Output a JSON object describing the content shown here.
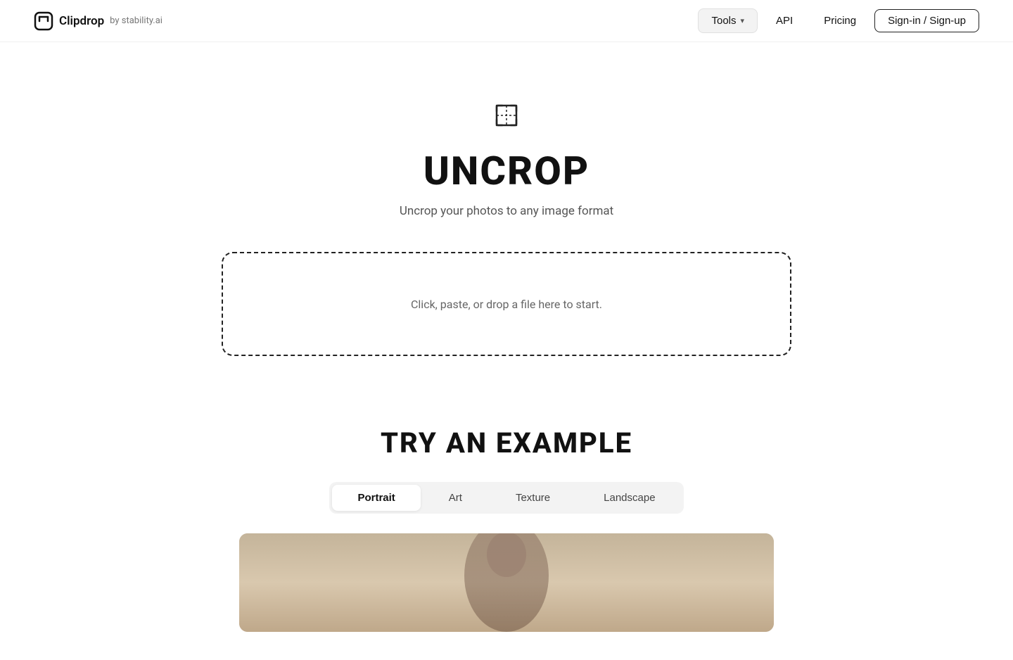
{
  "nav": {
    "logo_text": "Clipdrop",
    "logo_by": "by stability.ai",
    "tools_label": "Tools",
    "api_label": "API",
    "pricing_label": "Pricing",
    "signin_label": "Sign-in / Sign-up"
  },
  "hero": {
    "title": "UNCROP",
    "subtitle": "Uncrop your photos to any image format",
    "dropzone_text": "Click, paste, or drop a file here to start."
  },
  "examples": {
    "title": "TRY AN EXAMPLE",
    "tabs": [
      {
        "id": "portrait",
        "label": "Portrait",
        "active": true
      },
      {
        "id": "art",
        "label": "Art",
        "active": false
      },
      {
        "id": "texture",
        "label": "Texture",
        "active": false
      },
      {
        "id": "landscape",
        "label": "Landscape",
        "active": false
      }
    ]
  }
}
